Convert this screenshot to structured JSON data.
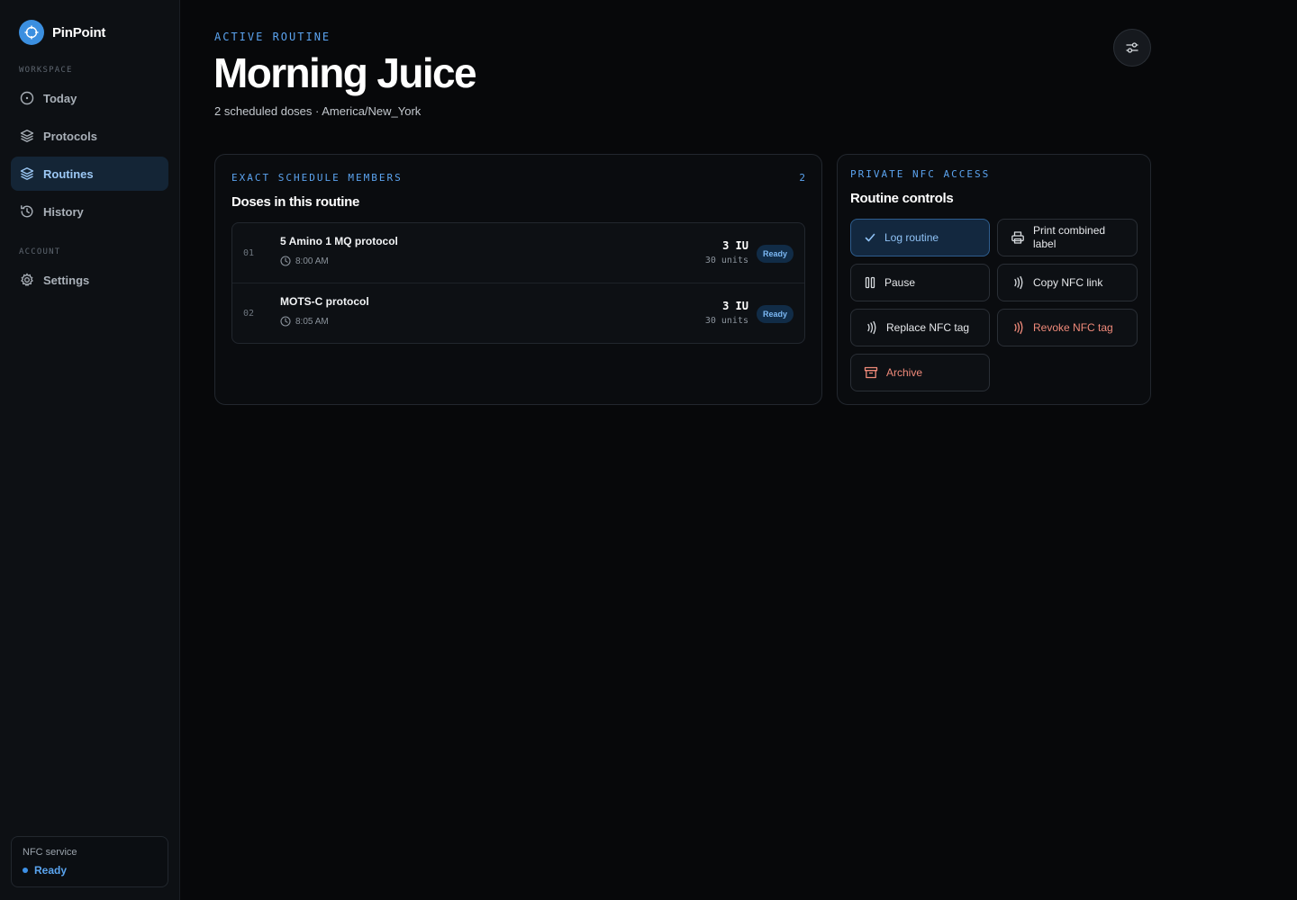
{
  "app": {
    "name": "PinPoint"
  },
  "sidebar": {
    "workspace_label": "WORKSPACE",
    "account_label": "ACCOUNT",
    "items": [
      {
        "label": "Today",
        "icon": "clock-icon",
        "active": false
      },
      {
        "label": "Protocols",
        "icon": "layers-icon",
        "active": false
      },
      {
        "label": "Routines",
        "icon": "layers-icon",
        "active": true
      },
      {
        "label": "History",
        "icon": "history-icon",
        "active": false
      }
    ],
    "account_items": [
      {
        "label": "Settings",
        "icon": "gear-icon"
      }
    ],
    "nfc_service": {
      "title": "NFC service",
      "status": "Ready"
    }
  },
  "header": {
    "eyebrow": "ACTIVE ROUTINE",
    "title": "Morning Juice",
    "subtitle": "2 scheduled doses · America/New_York"
  },
  "doses_card": {
    "eyebrow": "EXACT SCHEDULE MEMBERS",
    "count": "2",
    "title": "Doses in this routine",
    "rows": [
      {
        "index": "01",
        "name": "5 Amino 1 MQ protocol",
        "time": "8:00 AM",
        "amount": "3 IU",
        "units": "30 units",
        "status": "Ready"
      },
      {
        "index": "02",
        "name": "MOTS-C protocol",
        "time": "8:05 AM",
        "amount": "3 IU",
        "units": "30 units",
        "status": "Ready"
      }
    ]
  },
  "controls_card": {
    "eyebrow": "PRIVATE NFC ACCESS",
    "title": "Routine controls",
    "buttons": {
      "log": "Log routine",
      "print": "Print combined label",
      "pause": "Pause",
      "copy": "Copy NFC link",
      "replace": "Replace NFC tag",
      "revoke": "Revoke NFC tag",
      "archive": "Archive"
    }
  },
  "colors": {
    "accent": "#5ba3ef",
    "danger": "#f08a7a",
    "background": "#07080a",
    "sidebar": "#0d1014"
  }
}
